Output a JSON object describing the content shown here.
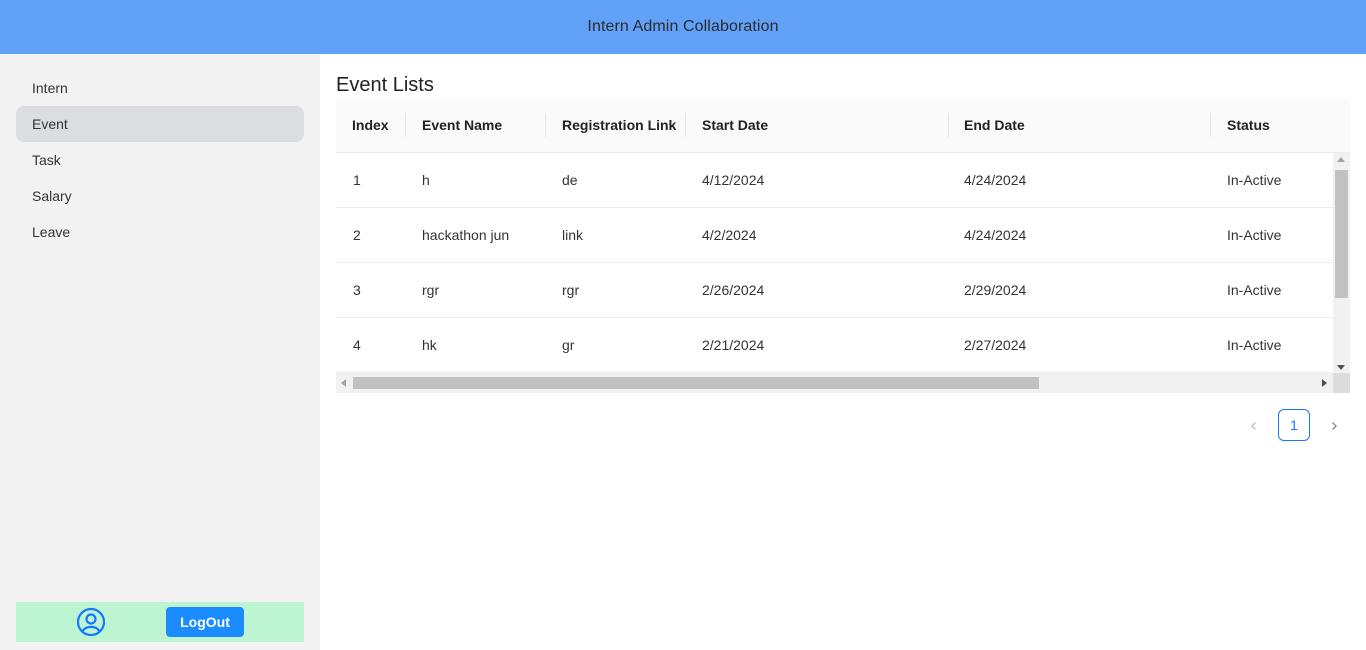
{
  "header": {
    "title": "Intern Admin Collaboration"
  },
  "sidebar": {
    "items": [
      {
        "label": "Intern",
        "active": false
      },
      {
        "label": "Event",
        "active": true
      },
      {
        "label": "Task",
        "active": false
      },
      {
        "label": "Salary",
        "active": false
      },
      {
        "label": "Leave",
        "active": false
      }
    ],
    "footer": {
      "user_icon": "user-circle-icon",
      "logout_label": "LogOut"
    }
  },
  "main": {
    "title": "Event Lists",
    "table": {
      "columns": [
        "Index",
        "Event Name",
        "Registration Link",
        "Start Date",
        "End Date",
        "Status"
      ],
      "rows": [
        [
          "1",
          "h",
          "de",
          "4/12/2024",
          "4/24/2024",
          "In-Active"
        ],
        [
          "2",
          "hackathon jun",
          "link",
          "4/2/2024",
          "4/24/2024",
          "In-Active"
        ],
        [
          "3",
          "rgr",
          "rgr",
          "2/26/2024",
          "2/29/2024",
          "In-Active"
        ],
        [
          "4",
          "hk",
          "gr",
          "2/21/2024",
          "2/27/2024",
          "In-Active"
        ]
      ]
    },
    "pagination": {
      "current_page": "1",
      "prev_icon": "chevron-left-icon",
      "next_icon": "chevron-right-icon"
    }
  },
  "colors": {
    "header_bg": "#61a2f8",
    "sidebar_bg": "#f2f2f2",
    "active_item_bg": "#dcdde0",
    "footer_bg": "#bdf5d2",
    "logout_bg": "#1a8cff",
    "accent": "#1677ff"
  }
}
